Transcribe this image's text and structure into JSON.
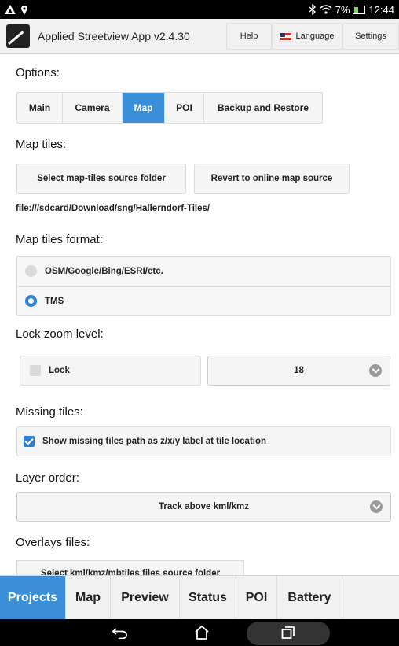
{
  "status_bar": {
    "clock": "12:44",
    "battery_percent": "7%",
    "icons": [
      "notification-icon",
      "location-icon",
      "bluetooth-icon",
      "wifi-icon",
      "battery-icon"
    ]
  },
  "header": {
    "title": "Applied Streetview App v2.4.30",
    "help_label": "Help",
    "language_label": "Language",
    "settings_label": "Settings"
  },
  "options": {
    "title": "Options:",
    "tabs": [
      {
        "label": "Main"
      },
      {
        "label": "Camera"
      },
      {
        "label": "Map",
        "active": true
      },
      {
        "label": "POI"
      },
      {
        "label": "Backup and Restore"
      }
    ]
  },
  "map_tiles": {
    "title": "Map tiles:",
    "select_folder_label": "Select map-tiles source folder",
    "revert_label": "Revert to online map source",
    "path": "file:///sdcard/Download/sng/Hallerndorf-Tiles/"
  },
  "tiles_format": {
    "title": "Map tiles format:",
    "options": [
      {
        "label": "OSM/Google/Bing/ESRI/etc.",
        "selected": false
      },
      {
        "label": "TMS",
        "selected": true
      }
    ]
  },
  "lock_zoom": {
    "title": "Lock zoom level:",
    "lock_label": "Lock",
    "locked": false,
    "zoom_value": "18"
  },
  "missing_tiles": {
    "title": "Missing tiles:",
    "show_label": "Show missing tiles path as z/x/y label at tile location",
    "checked": true
  },
  "layer_order": {
    "title": "Layer order:",
    "value": "Track above kml/kmz"
  },
  "overlays": {
    "title": "Overlays files:",
    "select_label": "Select kml/kmz/mbtiles files source folder"
  },
  "bottom_tabs": [
    {
      "label": "Projects",
      "active": true
    },
    {
      "label": "Map"
    },
    {
      "label": "Preview"
    },
    {
      "label": "Status"
    },
    {
      "label": "POI"
    },
    {
      "label": "Battery"
    }
  ],
  "colors": {
    "accent": "#3a8fd8",
    "radio_selected": "#2b7fd4"
  }
}
